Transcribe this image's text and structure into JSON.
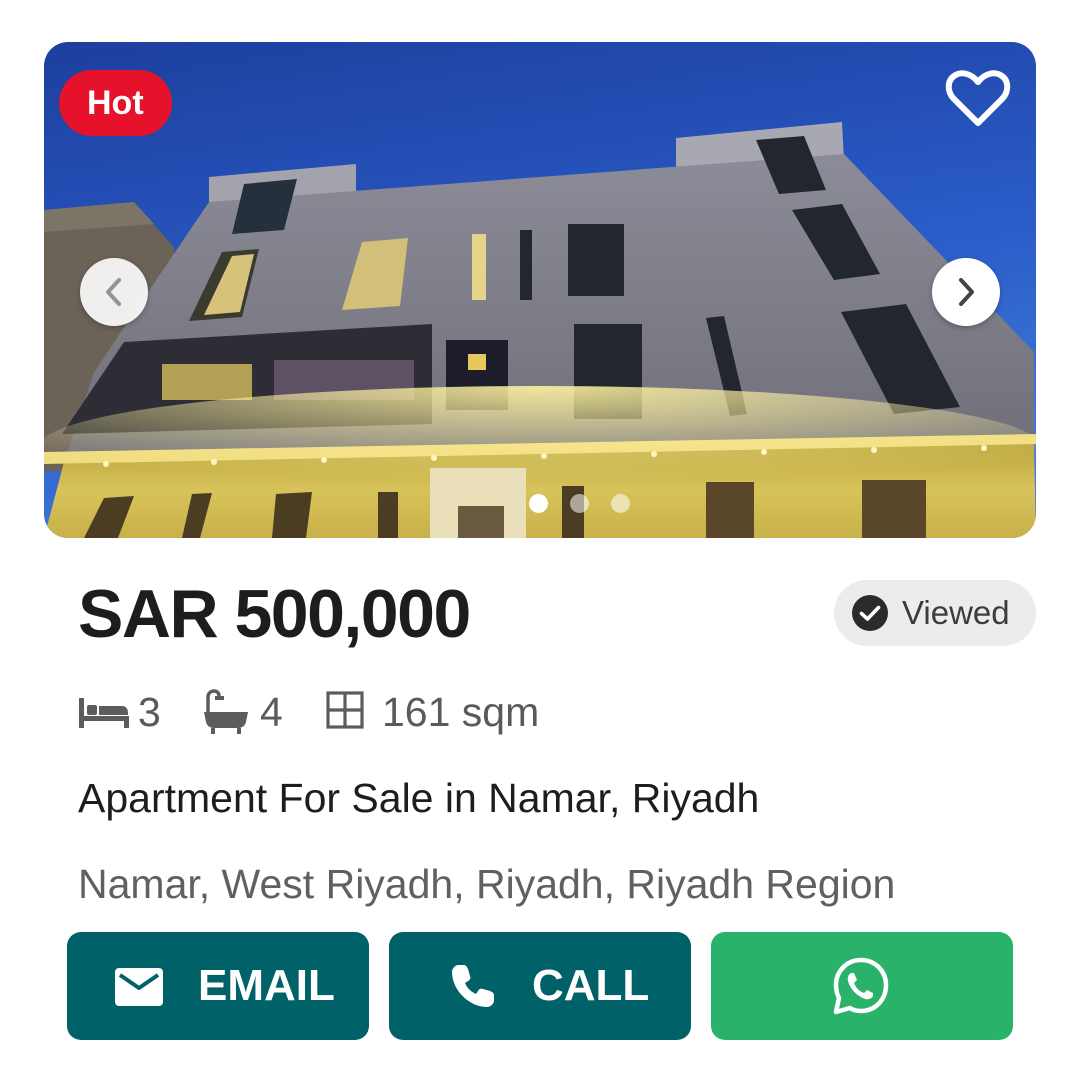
{
  "listing": {
    "badge": "Hot",
    "price": "SAR 500,000",
    "viewed_label": "Viewed",
    "bedrooms": "3",
    "bathrooms": "4",
    "area": "161 sqm",
    "title": "Apartment For Sale in Namar, Riyadh",
    "location": "Namar, West Riyadh, Riyadh, Riyadh Region"
  },
  "gallery": {
    "image_count": 3,
    "active_index": 1,
    "icons": {
      "favorite": "heart-outline-icon",
      "prev": "chevron-left-icon",
      "next": "chevron-right-icon"
    }
  },
  "actions": {
    "email_label": "EMAIL",
    "call_label": "CALL",
    "whatsapp_icon": "whatsapp-icon"
  },
  "colors": {
    "hot_badge": "#e6112a",
    "primary_button": "#006169",
    "whatsapp_button": "#2ab26a",
    "viewed_pill": "#ececec"
  }
}
